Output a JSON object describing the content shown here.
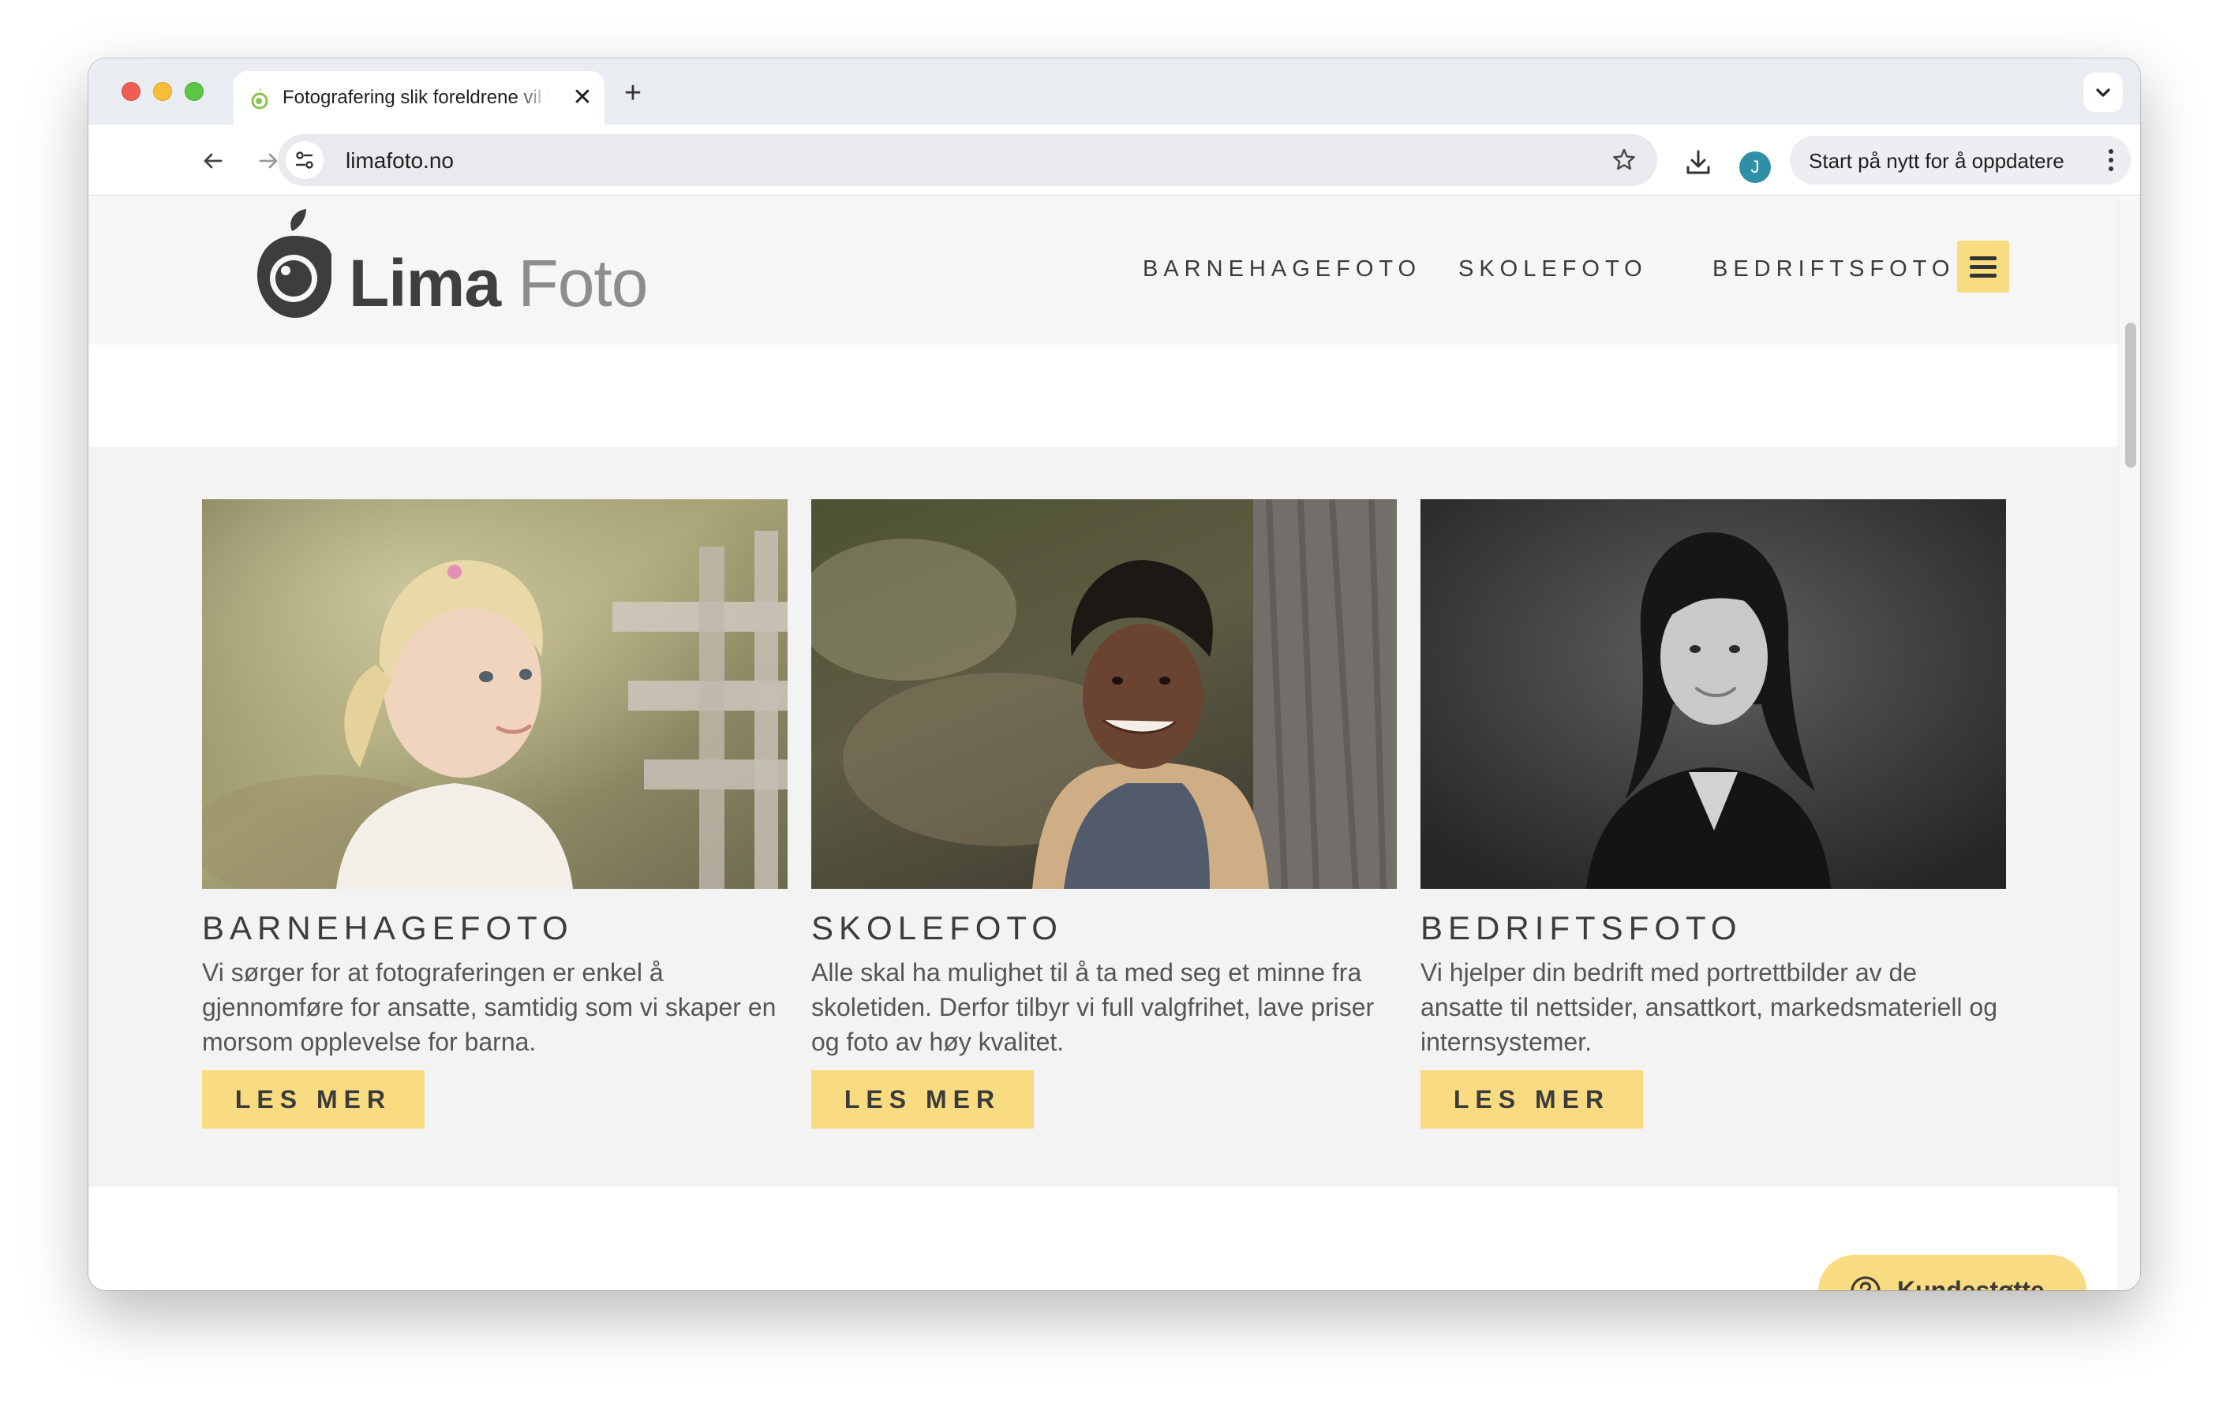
{
  "browser": {
    "tab_title": "Fotografering slik foreldrene vil ha det",
    "tab_close": "✕",
    "new_tab": "+",
    "url": "limafoto.no",
    "avatar_initial": "J",
    "update_label": "Start på nytt for å oppdatere"
  },
  "site": {
    "logo_word1": "Lima",
    "logo_word2": "Foto",
    "nav": [
      "BARNEHAGEFOTO",
      "SKOLEFOTO",
      "BEDRIFTSFOTO"
    ],
    "accent_color": "#f9dc82"
  },
  "cards": [
    {
      "heading": "BARNEHAGEFOTO",
      "text": "Vi sørger for at fotograferingen er enkel å gjennomføre for ansatte, samtidig som vi skaper en morsom opplevelse for barna.",
      "button": "LES MER"
    },
    {
      "heading": "SKOLEFOTO",
      "text": "Alle skal ha mulighet til å ta med seg et minne fra skoletiden. Derfor tilbyr vi full valgfrihet, lave priser og foto av høy kvalitet.",
      "button": "LES MER"
    },
    {
      "heading": "BEDRIFTSFOTO",
      "text": "Vi hjelper din bedrift med portrettbilder av de ansatte til nettsider, ansattkort, markedsmateriell og internsystemer.",
      "button": "LES MER"
    }
  ],
  "support": {
    "label": "Kundestøtte"
  }
}
